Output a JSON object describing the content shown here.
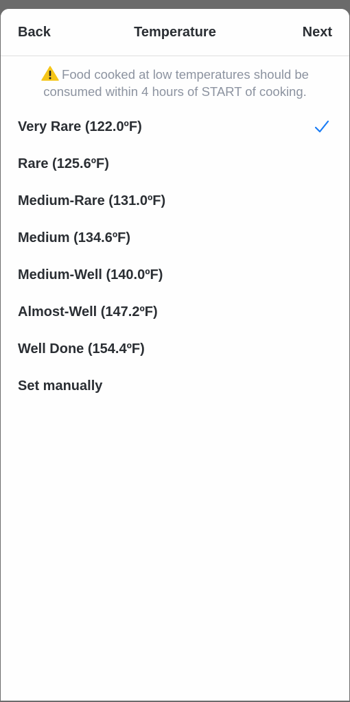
{
  "nav": {
    "back_label": "Back",
    "title": "Temperature",
    "next_label": "Next"
  },
  "warning": {
    "icon": "warning-icon",
    "text": "Food cooked at low temperatures should be consumed within 4 hours of START of cooking."
  },
  "options": [
    {
      "label": "Very Rare (122.0ºF)",
      "selected": true
    },
    {
      "label": "Rare (125.6ºF)",
      "selected": false
    },
    {
      "label": "Medium-Rare (131.0ºF)",
      "selected": false
    },
    {
      "label": "Medium (134.6ºF)",
      "selected": false
    },
    {
      "label": "Medium-Well (140.0ºF)",
      "selected": false
    },
    {
      "label": "Almost-Well (147.2ºF)",
      "selected": false
    },
    {
      "label": "Well Done (154.4ºF)",
      "selected": false
    },
    {
      "label": "Set manually",
      "selected": false
    }
  ],
  "colors": {
    "accent": "#1a7cf5",
    "text": "#2a2e33",
    "warning_text": "#8c93a0",
    "warning_icon": "#f5c518"
  }
}
